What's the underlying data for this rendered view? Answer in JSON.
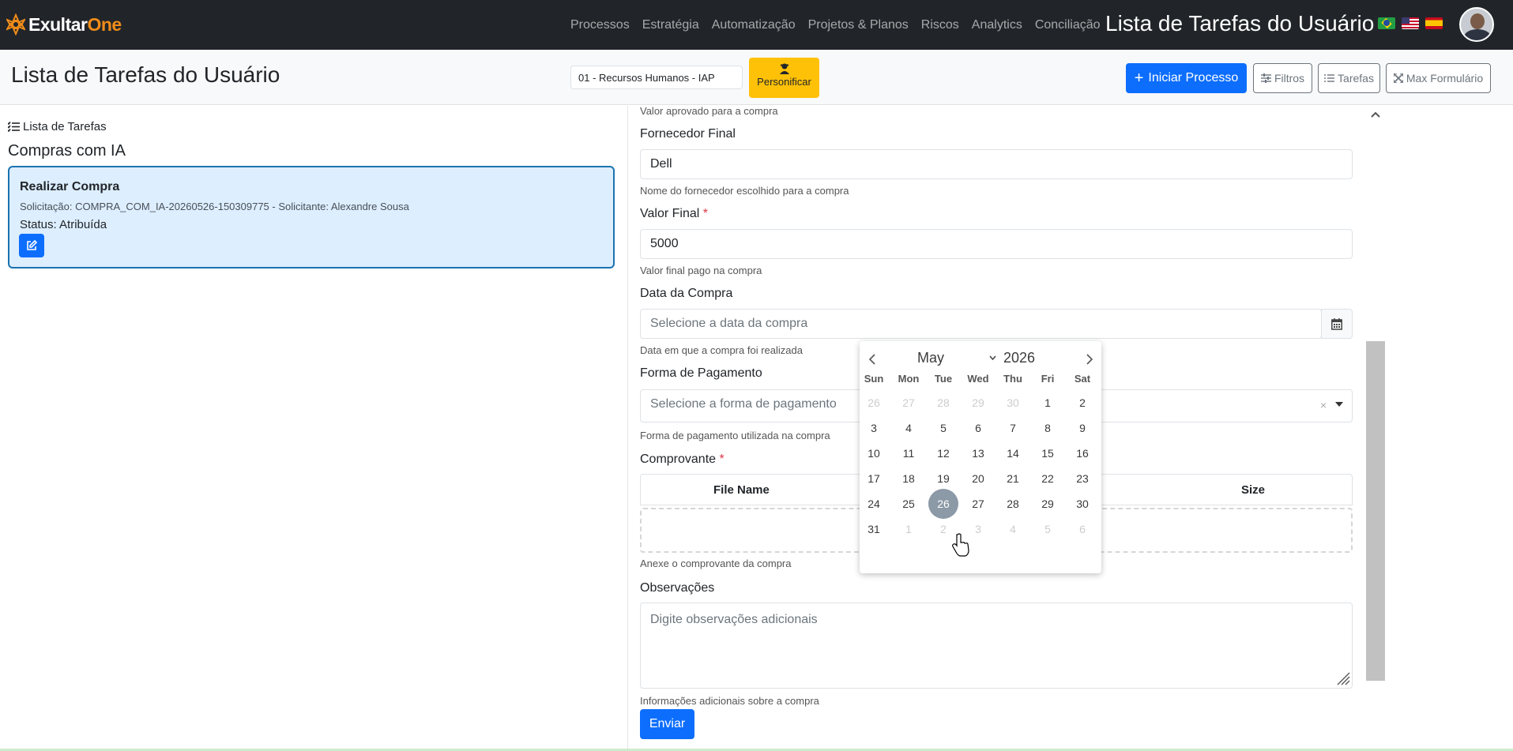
{
  "topnav": {
    "logo_text_a": "Exultar",
    "logo_text_b": "One",
    "menu": [
      "Processos",
      "Estratégia",
      "Automatização",
      "Projetos & Planos",
      "Riscos",
      "Analytics",
      "Conciliação"
    ],
    "title": "Lista de Tarefas do Usuário",
    "flags": [
      "flag-brazil-icon",
      "flag-usa-icon",
      "flag-spain-icon"
    ]
  },
  "subheader": {
    "title": "Lista de Tarefas do Usuário",
    "process_select": "01 - Recursos Humanos - IAP",
    "personificar": "Personificar",
    "iniciar": "Iniciar Processo",
    "filtros": "Filtros",
    "tarefas": "Tarefas",
    "max_form": "Max Formulário"
  },
  "left": {
    "heading": "Lista de Tarefas",
    "section": "Compras com IA",
    "task": {
      "title": "Realizar Compra",
      "subtitle": "Solicitação: COMPRA_COM_IA-20260526-150309775 - Solicitante: Alexandre Sousa",
      "status": "Status: Atribuída"
    }
  },
  "form": {
    "top_help": "Valor aprovado para a compra",
    "fornecedor": {
      "label": "Fornecedor Final",
      "value": "Dell",
      "help": "Nome do fornecedor escolhido para a compra"
    },
    "valor": {
      "label": "Valor Final",
      "req": "*",
      "value": "5000",
      "help": "Valor final pago na compra"
    },
    "data": {
      "label": "Data da Compra",
      "placeholder": "Selecione a data da compra",
      "help": "Data em que a compra foi realizada"
    },
    "pagamento": {
      "label": "Forma de Pagamento",
      "placeholder": "Selecione a forma de pagamento",
      "clear": "×",
      "help": "Forma de pagamento utilizada na compra"
    },
    "comprovante": {
      "label": "Comprovante",
      "req": "*",
      "col_name": "File Name",
      "col_size": "Size",
      "help": "Anexe o comprovante da compra"
    },
    "observacoes": {
      "label": "Observações",
      "placeholder": "Digite observações adicionais",
      "help": "Informações adicionais sobre a compra"
    },
    "submit": "Enviar"
  },
  "calendar": {
    "month": "May",
    "year": "2026",
    "dow": [
      "Sun",
      "Mon",
      "Tue",
      "Wed",
      "Thu",
      "Fri",
      "Sat"
    ],
    "weeks": [
      [
        "26",
        "27",
        "28",
        "29",
        "30",
        "1",
        "2"
      ],
      [
        "3",
        "4",
        "5",
        "6",
        "7",
        "8",
        "9"
      ],
      [
        "10",
        "11",
        "12",
        "13",
        "14",
        "15",
        "16"
      ],
      [
        "17",
        "18",
        "19",
        "20",
        "21",
        "22",
        "23"
      ],
      [
        "24",
        "25",
        "26",
        "27",
        "28",
        "29",
        "30"
      ],
      [
        "31",
        "1",
        "2",
        "3",
        "4",
        "5",
        "6"
      ]
    ],
    "selected": "26"
  }
}
